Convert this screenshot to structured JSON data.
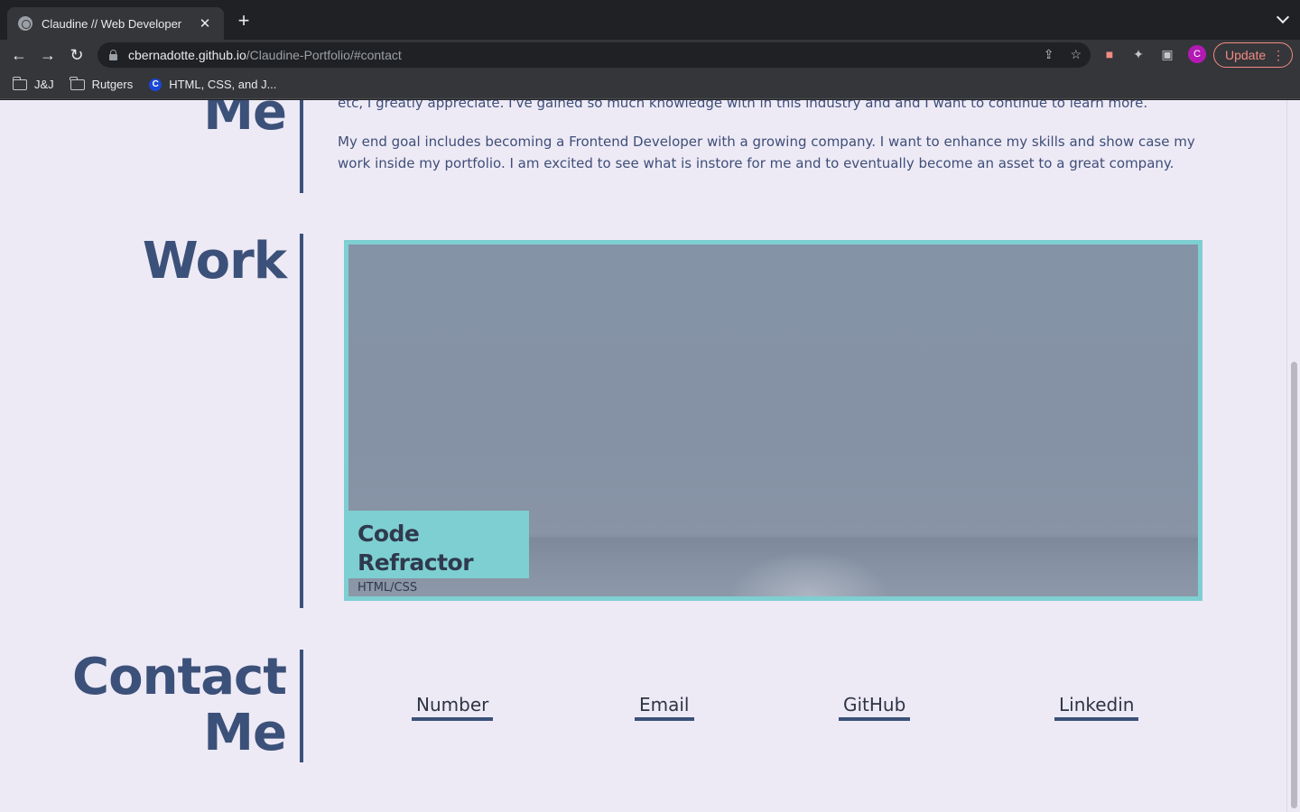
{
  "browser": {
    "tab_title": "Claudine // Web Developer",
    "tab_close": "✕",
    "new_tab": "+",
    "url_host": "cbernadotte.github.io",
    "url_path": "/Claudine-Portfolio/#contact",
    "profile_initial": "C",
    "update_label": "Update",
    "bookmarks": [
      "J&J",
      "Rutgers",
      "HTML, CSS, and J..."
    ]
  },
  "about": {
    "title_fragment": "Me",
    "paragraph_partial": "etc, I greatly appreciate. I've gained so much knowledge with in this industry and and I want to continue to learn more.",
    "paragraph_goal": "My end goal includes becoming a Frontend Developer with a growing company. I want to enhance my skills and show case my work inside my portfolio. I am excited to see what is instore for me and to eventually become an asset to a great company."
  },
  "work": {
    "title": "Work",
    "project": {
      "title": "Code Refractor",
      "tech": "HTML/CSS"
    }
  },
  "contact": {
    "title_line1": "Contact",
    "title_line2": "Me",
    "links": [
      "Number",
      "Email",
      "GitHub",
      "Linkedin"
    ]
  },
  "colors": {
    "page_bg": "#edeaf6",
    "accent": "#3c5179",
    "card_border": "#7ecfd1"
  }
}
